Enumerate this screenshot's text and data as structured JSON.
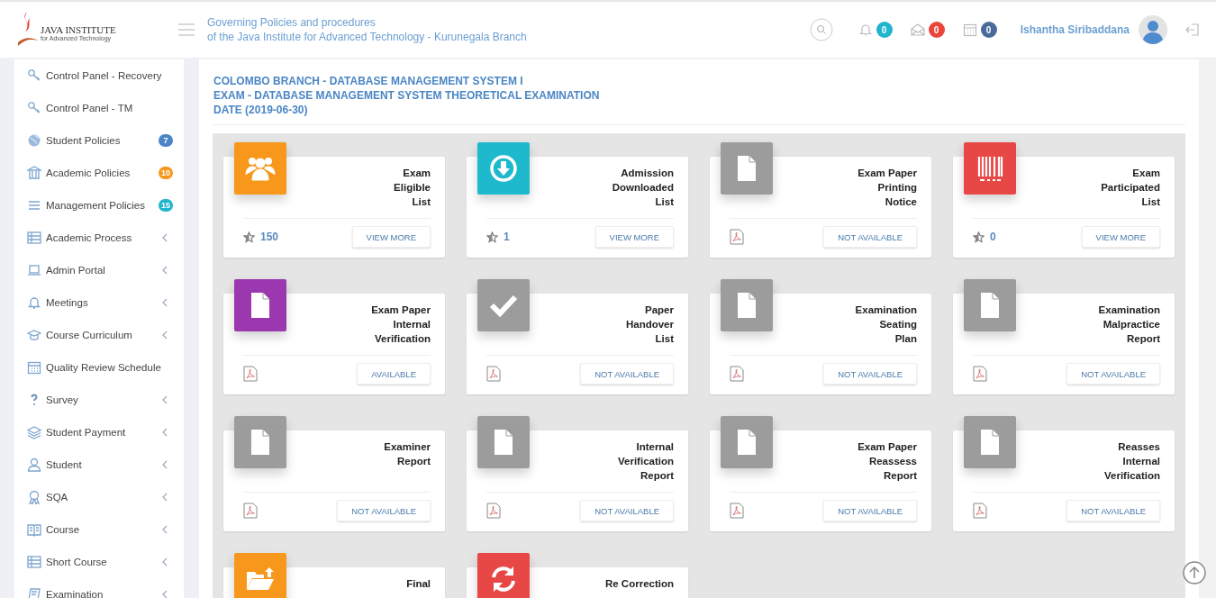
{
  "header": {
    "logo": {
      "name": "JAVA INSTITUTE",
      "subtitle": "for Advanced Technology"
    },
    "title_lines": [
      "Governing Policies and procedures",
      "of the Java Institute for Advanced Technology - Kurunegala Branch"
    ],
    "notifications": [
      {
        "count": "0",
        "color": "#1fb5cc"
      },
      {
        "count": "0",
        "color": "#e8453c"
      },
      {
        "count": "0",
        "color": "#4a6a9c"
      }
    ],
    "user": {
      "name": "Ishantha Siribaddana"
    }
  },
  "sidebar": {
    "items": [
      {
        "label": "Control Panel - Recovery",
        "submenu": false
      },
      {
        "label": "Control Panel - TM",
        "submenu": false
      },
      {
        "label": "Student Policies",
        "submenu": false,
        "badge": "7",
        "color": "#4a86c5"
      },
      {
        "label": "Academic Policies",
        "submenu": false,
        "badge": "10",
        "color": "#f5981f"
      },
      {
        "label": "Management Policies",
        "submenu": false,
        "badge": "15",
        "color": "#1fb5cc"
      },
      {
        "label": "Academic Process",
        "submenu": true
      },
      {
        "label": "Admin Portal",
        "submenu": true
      },
      {
        "label": "Meetings",
        "submenu": true
      },
      {
        "label": "Course Curriculum",
        "submenu": true
      },
      {
        "label": "Quality Review Schedule",
        "submenu": false
      },
      {
        "label": "Survey",
        "submenu": true
      },
      {
        "label": "Student Payment",
        "submenu": true
      },
      {
        "label": "Student",
        "submenu": true
      },
      {
        "label": "SQA",
        "submenu": true
      },
      {
        "label": "Course",
        "submenu": true
      },
      {
        "label": "Short Course",
        "submenu": true
      },
      {
        "label": "Examination",
        "submenu": true
      }
    ]
  },
  "panel": {
    "heading_lines": [
      "COLOMBO BRANCH - DATABASE MANAGEMENT SYSTEM I",
      "EXAM - DATABASE MANAGEMENT SYSTEM THEORETICAL EXAMINATION",
      "DATE (2019-06-30)"
    ],
    "cards": [
      {
        "title_lines": [
          "Exam",
          "Eligible",
          "List"
        ],
        "color": "#f7981c",
        "kind": "count",
        "count": "150",
        "button": "VIEW MORE"
      },
      {
        "title_lines": [
          "Admission",
          "Downloaded",
          "List"
        ],
        "color": "#1fb9cd",
        "kind": "count",
        "count": "1",
        "button": "VIEW MORE"
      },
      {
        "title_lines": [
          "Exam Paper",
          "Printing",
          "Notice"
        ],
        "color": "#9c9c9c",
        "kind": "pdf",
        "button": "NOT AVAILABLE"
      },
      {
        "title_lines": [
          "Exam",
          "Participated",
          "List"
        ],
        "color": "#e84845",
        "kind": "count",
        "count": "0",
        "button": "VIEW MORE"
      },
      {
        "title_lines": [
          "Exam Paper",
          "Internal",
          "Verification"
        ],
        "color": "#9b38b0",
        "kind": "pdf",
        "button": "AVAILABLE"
      },
      {
        "title_lines": [
          "Paper",
          "Handover",
          "List"
        ],
        "color": "#9c9c9c",
        "kind": "pdf",
        "button": "NOT AVAILABLE"
      },
      {
        "title_lines": [
          "Examination",
          "Seating",
          "Plan"
        ],
        "color": "#9c9c9c",
        "kind": "pdf",
        "button": "NOT AVAILABLE"
      },
      {
        "title_lines": [
          "Examination",
          "Malpractice",
          "Report"
        ],
        "color": "#9c9c9c",
        "kind": "pdf",
        "button": "NOT AVAILABLE"
      },
      {
        "title_lines": [
          "Examiner",
          "Report"
        ],
        "color": "#9c9c9c",
        "kind": "pdf",
        "button": "NOT AVAILABLE"
      },
      {
        "title_lines": [
          "Internal",
          "Verification",
          "Report"
        ],
        "color": "#9c9c9c",
        "kind": "pdf",
        "button": "NOT AVAILABLE"
      },
      {
        "title_lines": [
          "Exam Paper",
          "Reassess",
          "Report"
        ],
        "color": "#9c9c9c",
        "kind": "pdf",
        "button": "NOT AVAILABLE"
      },
      {
        "title_lines": [
          "Reasses",
          "Internal",
          "Verification"
        ],
        "color": "#9c9c9c",
        "kind": "pdf",
        "button": "NOT AVAILABLE"
      },
      {
        "title_lines": [
          "Final"
        ],
        "color": "#f7981c",
        "kind": "cut"
      },
      {
        "title_lines": [
          "Re Correction"
        ],
        "color": "#e84845",
        "kind": "cut"
      }
    ]
  }
}
